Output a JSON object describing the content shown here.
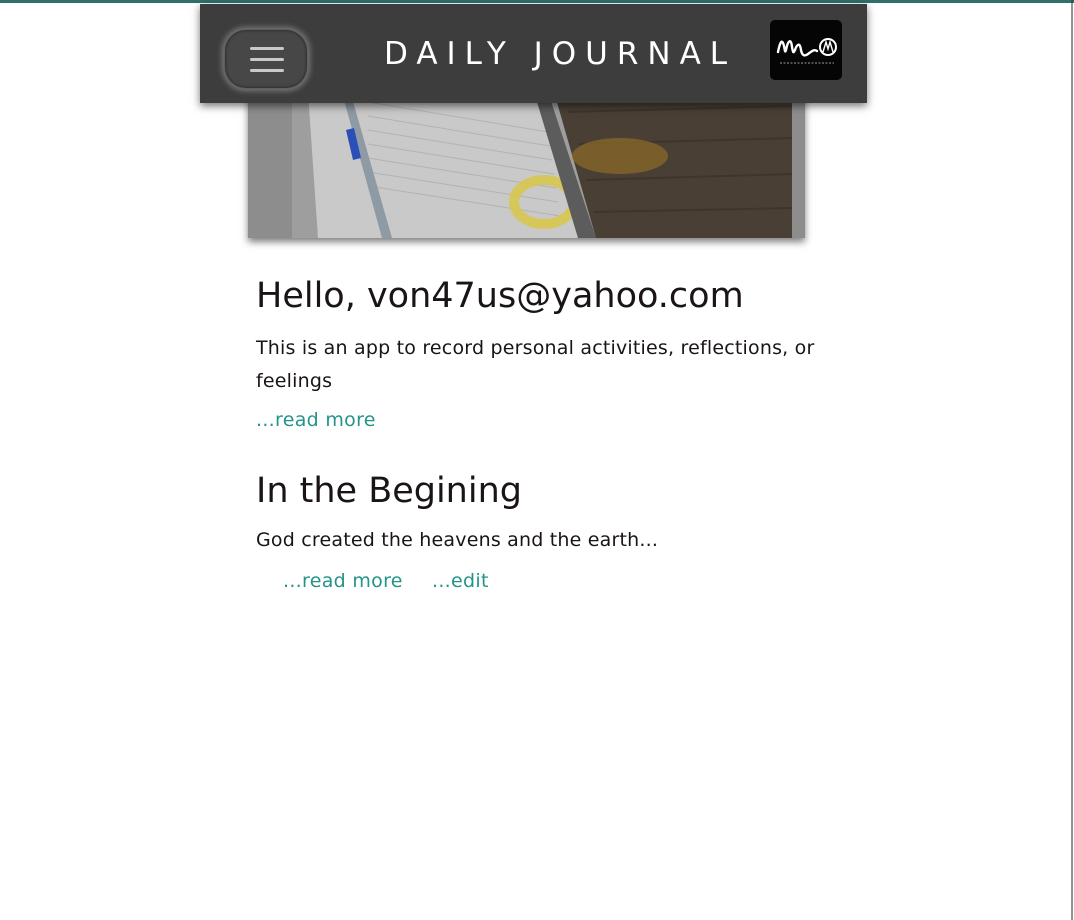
{
  "header": {
    "title": "DAILY JOURNAL",
    "menu_icon": "hamburger-menu-icon",
    "logo_icon": "mw-web-app-designer-logo",
    "logo_text": "mw",
    "logo_caption": "WEB APP DESIGNER"
  },
  "hero": {
    "icon": "journal-notebook-pen-photo"
  },
  "intro": {
    "heading": "Hello, von47us@yahoo.com",
    "body": "This is an app to record personal activities, reflections, or feelings",
    "read_more": "...read more"
  },
  "entries": [
    {
      "title": "In the Begining",
      "excerpt": "God created the heavens and the earth...",
      "read_more": "...read more",
      "edit": "...edit"
    }
  ],
  "colors": {
    "accent_link": "#24948a",
    "header_bg": "#3d3d3d",
    "top_rule": "#2f6f6c",
    "text": "#1a1414"
  }
}
